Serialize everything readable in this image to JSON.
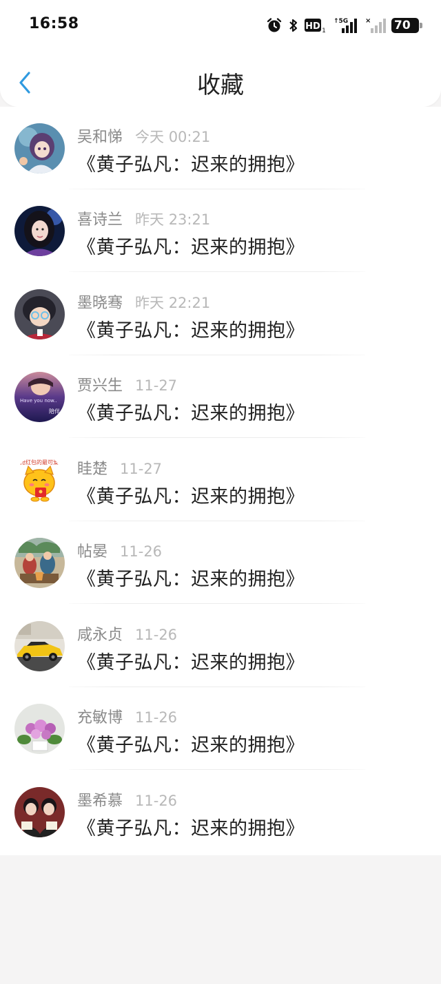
{
  "status_bar": {
    "time": "16:58",
    "battery": "70",
    "icons": [
      "alarm-icon",
      "bluetooth-icon",
      "hd-icon",
      "signal-5g-icon",
      "signal-icon"
    ]
  },
  "header": {
    "title": "收藏",
    "back_icon": "chevron-left-icon",
    "accent_color": "#2f9ae0"
  },
  "favorites": [
    {
      "name": "吴和悌",
      "time": "今天 00:21",
      "title": "《黄子弘凡：迟来的拥抱》"
    },
    {
      "name": "喜诗兰",
      "time": "昨天 23:21",
      "title": "《黄子弘凡：迟来的拥抱》"
    },
    {
      "name": "墨晓骞",
      "time": "昨天 22:21",
      "title": "《黄子弘凡：迟来的拥抱》"
    },
    {
      "name": "贾兴生",
      "time": "11-27",
      "title": "《黄子弘凡：迟来的拥抱》"
    },
    {
      "name": "眭楚",
      "time": "11-27",
      "title": "《黄子弘凡：迟来的拥抱》"
    },
    {
      "name": "帖晏",
      "time": "11-26",
      "title": "《黄子弘凡：迟来的拥抱》"
    },
    {
      "name": "咸永贞",
      "time": "11-26",
      "title": "《黄子弘凡：迟来的拥抱》"
    },
    {
      "name": "充敏博",
      "time": "11-26",
      "title": "《黄子弘凡：迟来的拥抱》"
    },
    {
      "name": "墨希慕",
      "time": "11-26",
      "title": "《黄子弘凡：迟来的拥抱》"
    }
  ]
}
